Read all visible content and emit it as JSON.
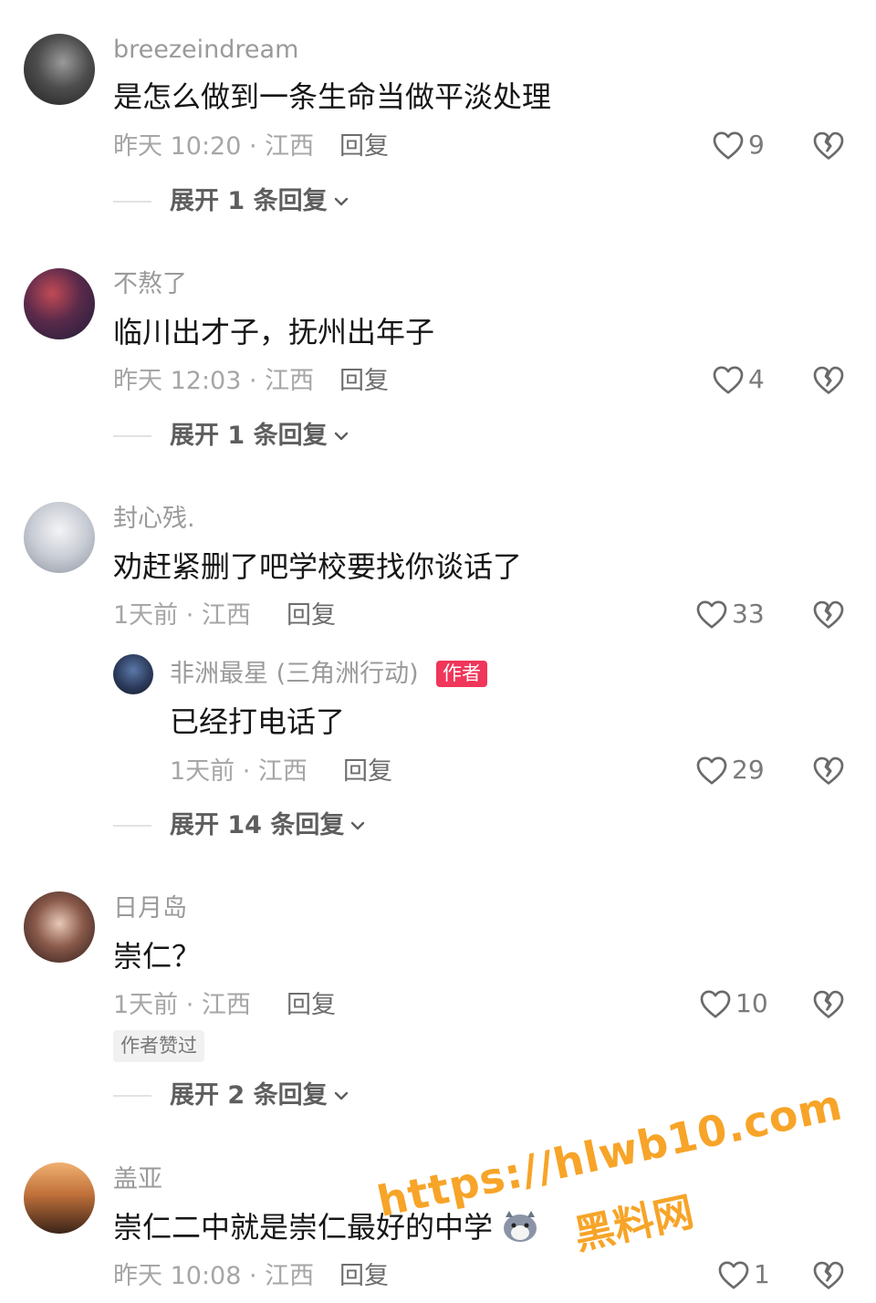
{
  "comments": [
    {
      "username": "breezeindream",
      "text": "是怎么做到一条生命当做平淡处理",
      "meta": "昨天 10:20 · 江西",
      "reply_label": "回复",
      "likes": "9",
      "expand_label": "展开 1 条回复"
    },
    {
      "username": "不熬了",
      "text": "临川出才子，抚州出年子",
      "meta": "昨天 12:03 · 江西",
      "reply_label": "回复",
      "likes": "4",
      "expand_label": "展开 1 条回复"
    },
    {
      "username": "封心残.",
      "text": "劝赶紧删了吧学校要找你谈话了",
      "meta": "1天前 · 江西",
      "reply_label": "回复",
      "likes": "33",
      "reply": {
        "username": "非洲最星 (三角洲行动)",
        "author_badge": "作者",
        "text": "已经打电话了",
        "meta": "1天前 · 江西",
        "reply_label": "回复",
        "likes": "29"
      },
      "expand_label": "展开 14 条回复"
    },
    {
      "username": "日月岛",
      "text": "崇仁？",
      "meta": "1天前 · 江西",
      "reply_label": "回复",
      "likes": "10",
      "liked_badge": "作者赞过",
      "expand_label": "展开 2 条回复"
    },
    {
      "username": "盖亚",
      "text": "崇仁二中就是崇仁最好的中学",
      "meta": "昨天 10:08 · 江西",
      "reply_label": "回复",
      "likes": "1"
    }
  ],
  "watermark": {
    "url": "https://hlwb10.com",
    "name": "黑料网"
  },
  "colors": {
    "author_badge": "#f0365a",
    "watermark": "#f7a428"
  },
  "icons": [
    "heart-icon",
    "broken-heart-icon",
    "chevron-down-icon",
    "emoji-icon"
  ]
}
